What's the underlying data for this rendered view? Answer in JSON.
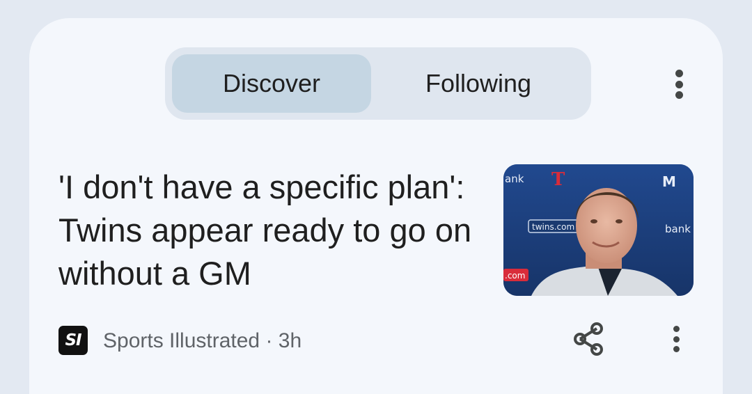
{
  "tabs": [
    {
      "label": "Discover",
      "selected": true
    },
    {
      "label": "Following",
      "selected": false
    }
  ],
  "article": {
    "headline": "'I don't have a specific plan': Twins appear ready to go on without a GM",
    "source_logo_text": "SI",
    "source": "Sports Illustrated",
    "separator": "·",
    "age": "3h"
  },
  "thumbnail_signage": [
    "ank",
    "twins.com",
    "bank",
    ".com"
  ],
  "icons": {
    "menu": "more-vert-icon",
    "share": "share-icon"
  },
  "colors": {
    "background": "#e3e9f2",
    "card": "#f4f7fc",
    "segment_bg": "#dfe6ef",
    "segment_selected": "#c5d6e3",
    "text_primary": "#1f1f1f",
    "text_secondary": "#5f6368"
  }
}
